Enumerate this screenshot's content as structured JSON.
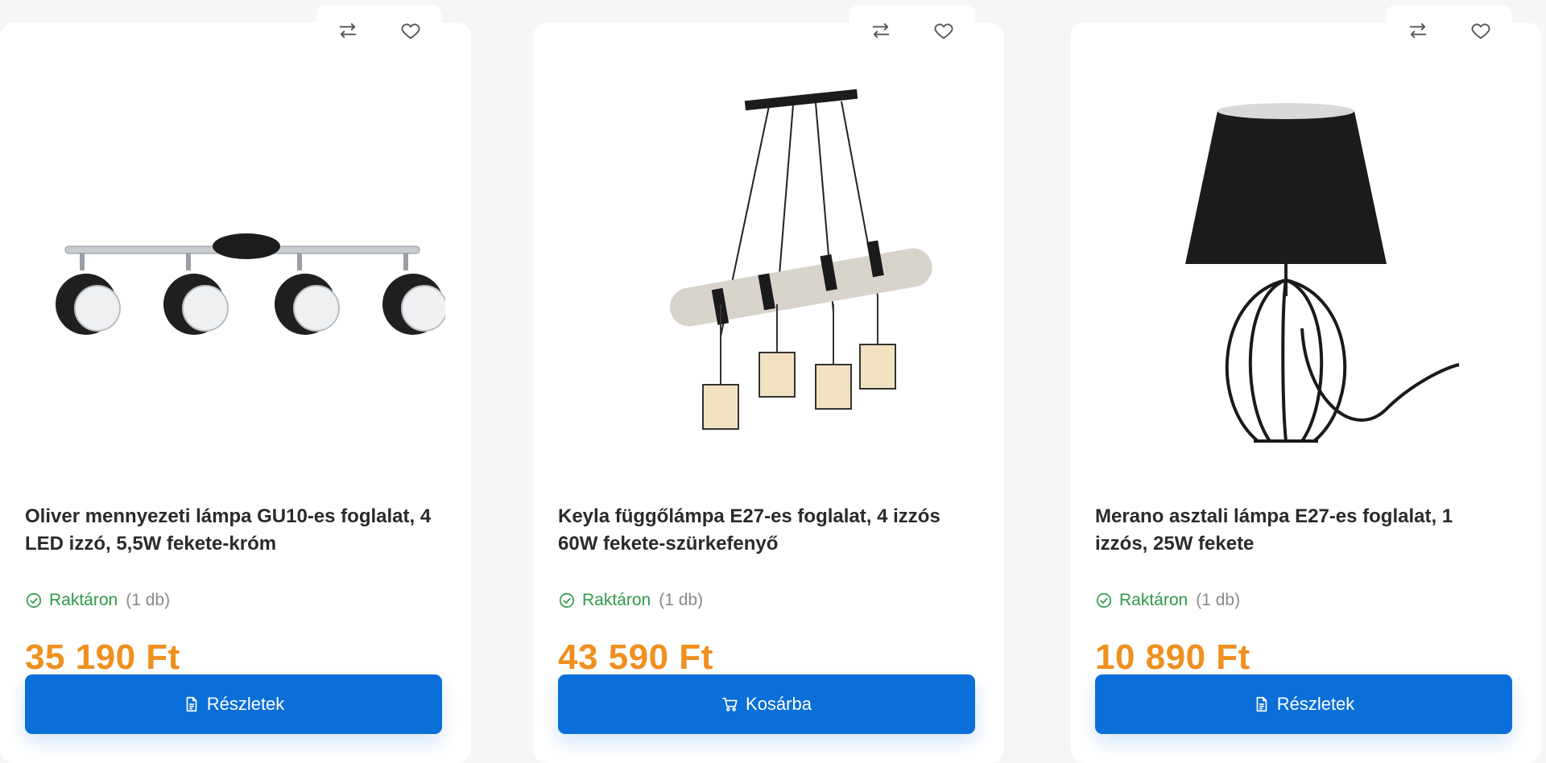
{
  "products": [
    {
      "title": "Oliver mennyezeti lámpa GU10-es foglalat, 4 LED izzó, 5,5W fekete-króm",
      "stock_label": "Raktáron",
      "stock_qty": "(1 db)",
      "price": "35 190 Ft",
      "button_label": "Részletek",
      "button_icon": "document-icon"
    },
    {
      "title": "Keyla függőlámpa E27-es foglalat, 4 izzós 60W fekete-szürkefenyő",
      "stock_label": "Raktáron",
      "stock_qty": "(1 db)",
      "price": "43 590 Ft",
      "button_label": "Kosárba",
      "button_icon": "cart-icon"
    },
    {
      "title": "Merano asztali lámpa E27-es foglalat, 1 izzós, 25W fekete",
      "stock_label": "Raktáron",
      "stock_qty": "(1 db)",
      "price": "10 890 Ft",
      "button_label": "Részletek",
      "button_icon": "document-icon"
    }
  ],
  "colors": {
    "price": "#f0901f",
    "button": "#0a6fd8",
    "stock": "#2e9a49"
  }
}
